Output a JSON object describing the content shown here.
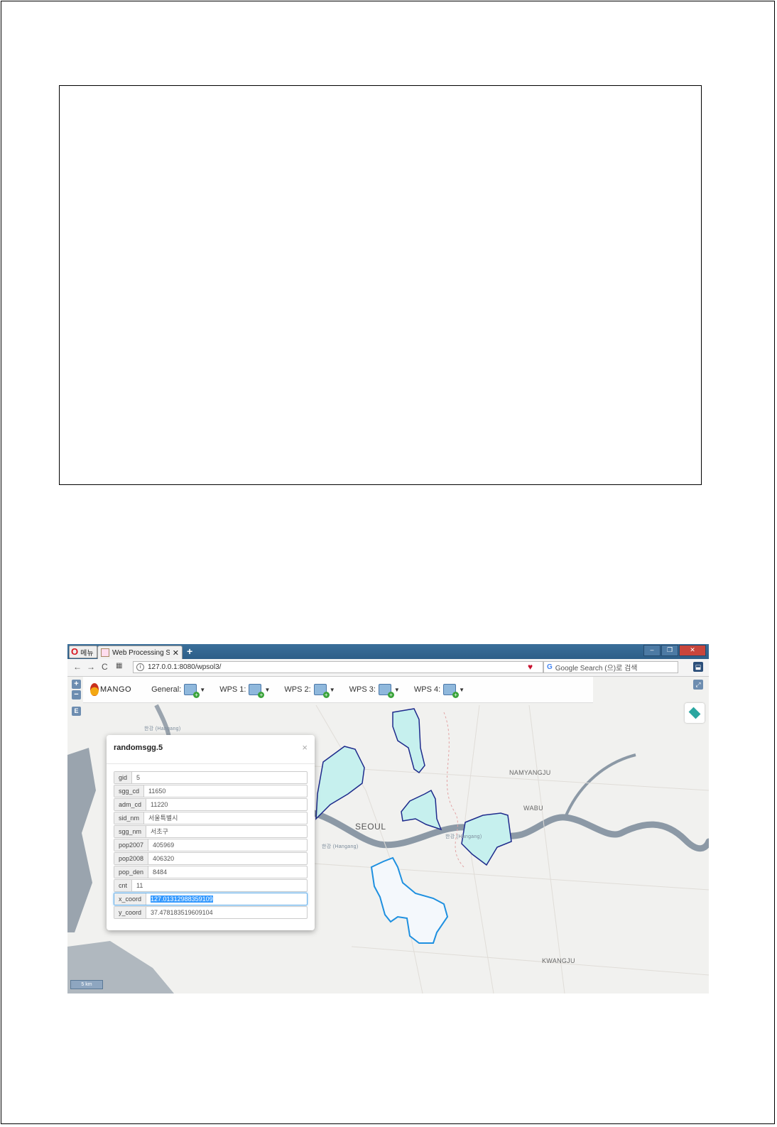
{
  "browser": {
    "menu_label": "메뉴",
    "tab_title": "Web Processing Services",
    "url": "127.0.0.1:8080/wpsol3/",
    "search_placeholder": "Google Search (으)로 검색"
  },
  "toolbar": {
    "logo": "MANGO",
    "menus": [
      {
        "label": "General:"
      },
      {
        "label": "WPS 1:"
      },
      {
        "label": "WPS 2:"
      },
      {
        "label": "WPS 3:"
      },
      {
        "label": "WPS 4:"
      }
    ]
  },
  "map": {
    "zoom_in": "+",
    "zoom_out": "−",
    "edit_button": "E",
    "scale": "5 km",
    "labels": {
      "seoul": "SEOUL",
      "namyangju": "NAMYANGJU",
      "wabu": "WABU",
      "kwangju": "KWANGJU",
      "hangang_1": "한강 (Hangang)",
      "hangang_2": "한강 (Hangang)",
      "hangang_3": "한강 (Hangang)"
    },
    "colors": {
      "region_fill": "#c6f0ee",
      "region_stroke": "#1e2b8c",
      "selected_stroke": "#1e90e0",
      "river": "#8c99a6"
    }
  },
  "popup": {
    "title": "randomsgg.5",
    "close": "×",
    "rows": [
      {
        "key": "gid",
        "value": "5"
      },
      {
        "key": "sgg_cd",
        "value": "11650"
      },
      {
        "key": "adm_cd",
        "value": "11220"
      },
      {
        "key": "sid_nm",
        "value": "서울특별시"
      },
      {
        "key": "sgg_nm",
        "value": "서초구"
      },
      {
        "key": "pop2007",
        "value": "405969"
      },
      {
        "key": "pop2008",
        "value": "406320"
      },
      {
        "key": "pop_den",
        "value": "8484"
      },
      {
        "key": "cnt",
        "value": "11"
      },
      {
        "key": "x_coord",
        "value": "127.01312988359109"
      },
      {
        "key": "y_coord",
        "value": "37.478183519609104"
      }
    ]
  }
}
